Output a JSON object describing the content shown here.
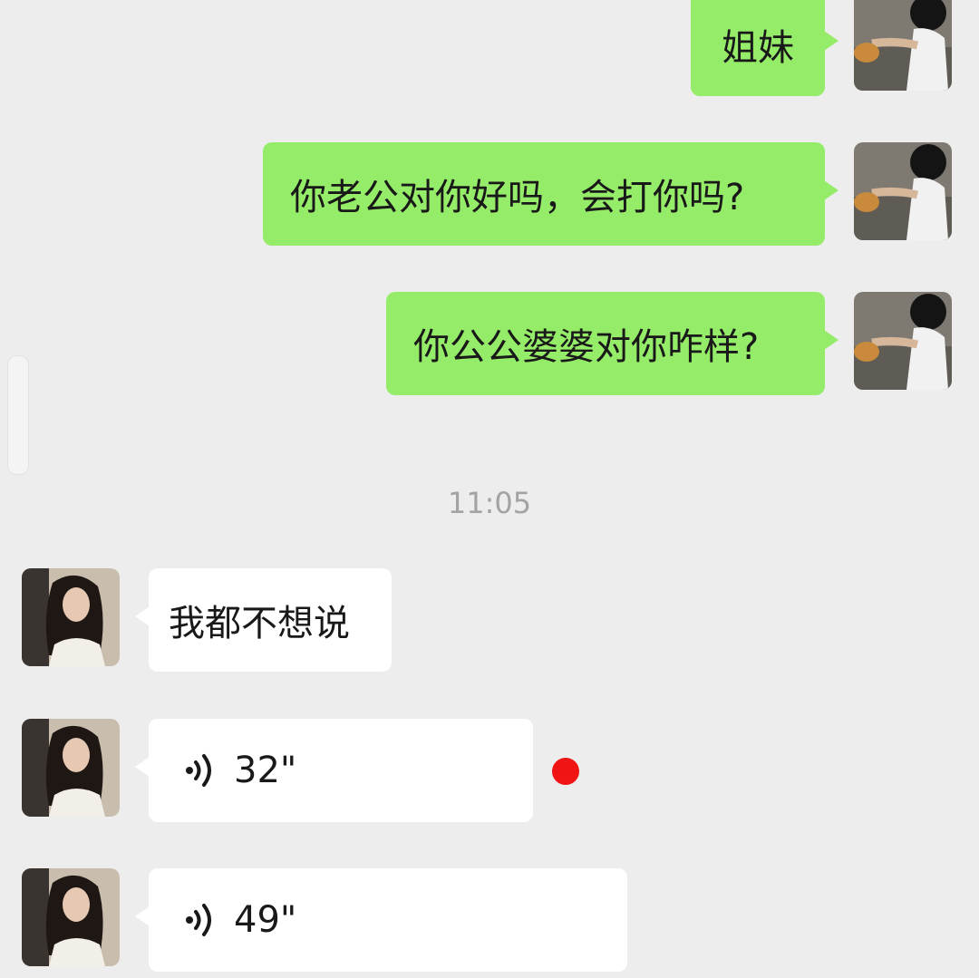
{
  "colors": {
    "background": "#ededed",
    "sent_bubble": "#95ec69",
    "received_bubble": "#ffffff",
    "unread_dot": "#f01414",
    "timestamp_text": "#a3a3a3"
  },
  "messages_sent": [
    {
      "text": "姐妹"
    },
    {
      "text": "你老公对你好吗，会打你吗?"
    },
    {
      "text": "你公公婆婆对你咋样?"
    }
  ],
  "timestamp": "11:05",
  "messages_received": [
    {
      "type": "text",
      "text": "我都不想说"
    },
    {
      "type": "voice",
      "duration": "32\"",
      "unread": true,
      "icon": "voice-wave-icon"
    },
    {
      "type": "voice",
      "duration": "49\"",
      "unread": false,
      "icon": "voice-wave-icon"
    }
  ]
}
